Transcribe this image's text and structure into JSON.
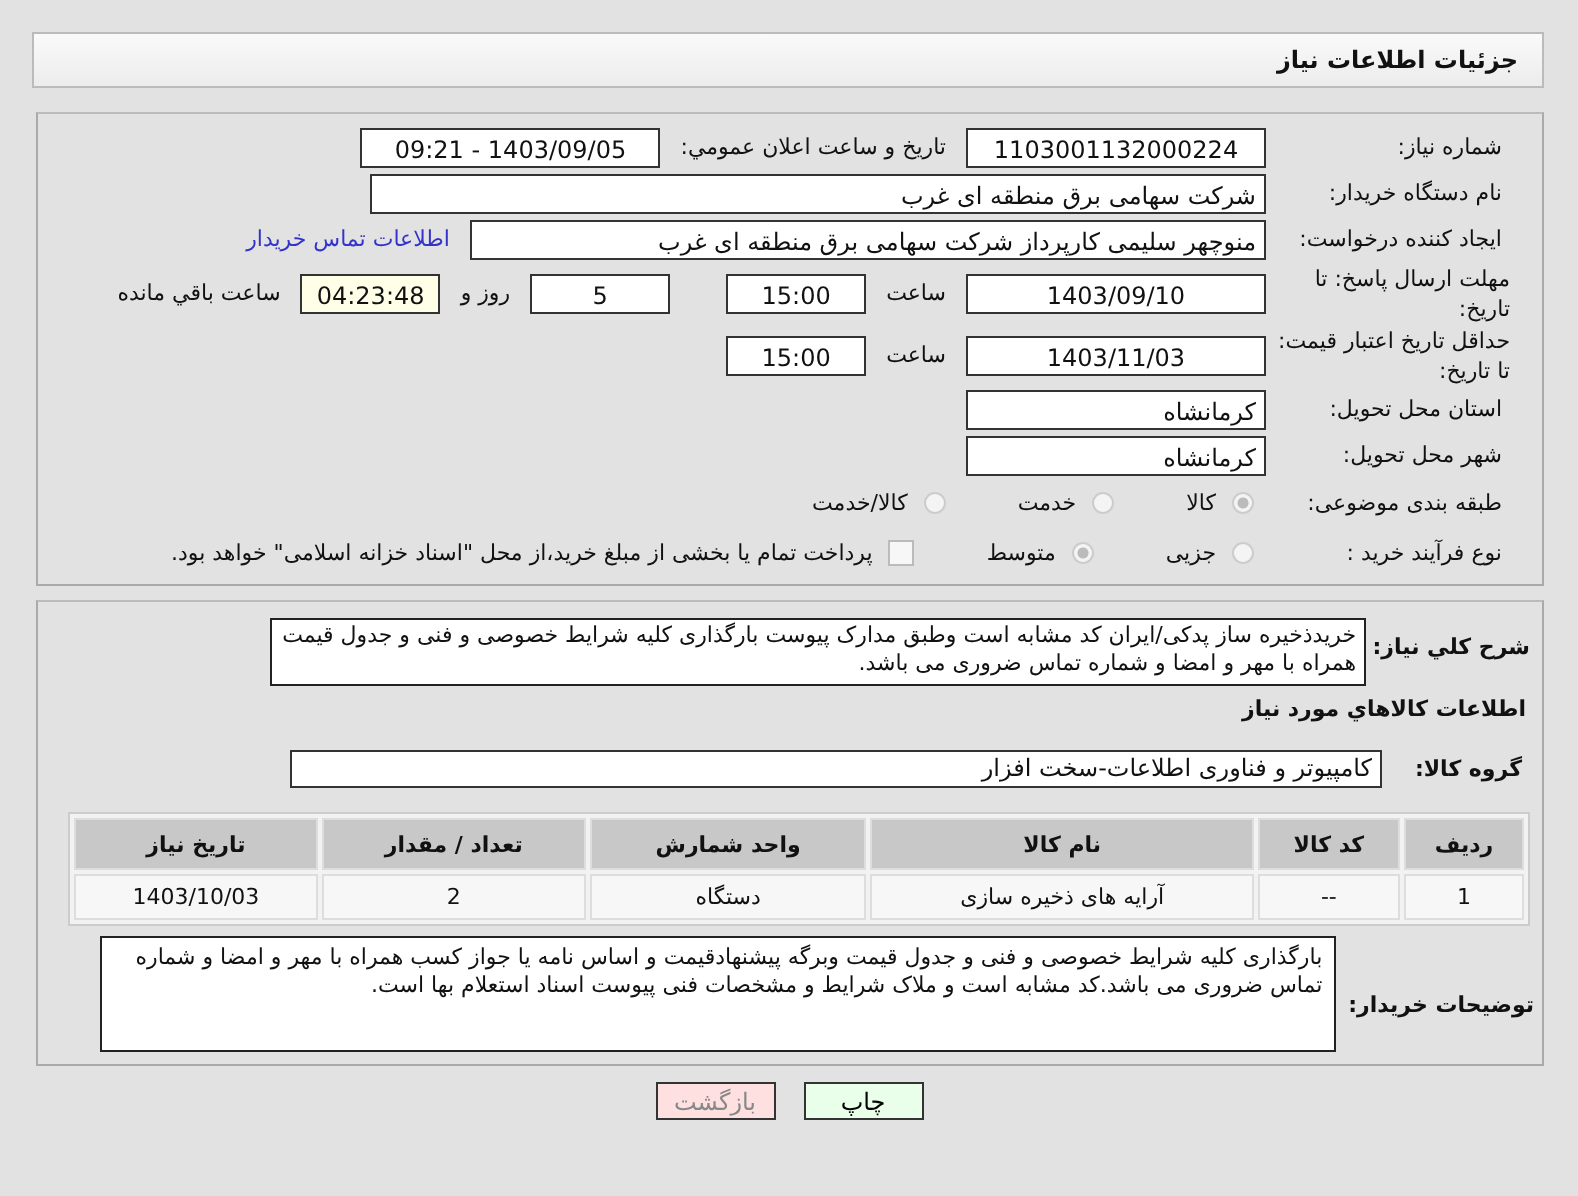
{
  "header": {
    "title": "جزئیات اطلاعات نیاز"
  },
  "need_number": {
    "label": "شماره نیاز:",
    "value": "1103001132000224"
  },
  "announce": {
    "label": "تاریخ و ساعت اعلان عمومي:",
    "value": "1403/09/05 - 09:21"
  },
  "buyer_org": {
    "label": "نام دستگاه خریدار:",
    "value": "شرکت سهامی برق منطقه ای غرب"
  },
  "requester": {
    "label": "ایجاد کننده درخواست:",
    "value": "منوچهر  سلیمی کارپرداز شرکت سهامی برق منطقه ای غرب",
    "link": "اطلاعات تماس خریدار"
  },
  "reply_deadline": {
    "label": "مهلت ارسال پاسخ: تا تاریخ:",
    "date": "1403/09/10",
    "time_label": "ساعت",
    "time": "15:00",
    "days": "5",
    "days_label": "روز و",
    "remaining": "04:23:48",
    "remaining_label": "ساعت باقي مانده"
  },
  "price_validity": {
    "label": "حداقل تاریخ اعتبار قیمت: تا تاریخ:",
    "date": "1403/11/03",
    "time_label": "ساعت",
    "time": "15:00"
  },
  "province": {
    "label": "استان محل تحویل:",
    "value": "کرمانشاه"
  },
  "city": {
    "label": "شهر محل تحویل:",
    "value": "کرمانشاه"
  },
  "category": {
    "label": "طبقه بندی موضوعی:",
    "options": [
      {
        "label": "کالا",
        "selected": true
      },
      {
        "label": "خدمت",
        "selected": false
      },
      {
        "label": "کالا/خدمت",
        "selected": false
      }
    ]
  },
  "purchase_type": {
    "label": "نوع فرآیند خرید :",
    "options": [
      {
        "label": "جزیی",
        "selected": false
      },
      {
        "label": "متوسط",
        "selected": true
      }
    ],
    "payment": {
      "checked": false,
      "label": "پرداخت تمام یا بخشی از مبلغ خرید،از محل \"اسناد خزانه اسلامی\" خواهد بود."
    }
  },
  "description": {
    "label": "شرح کلي نیاز:",
    "value": "خریدذخیره ساز پدکی/ایران کد مشابه است وطبق مدارک پیوست بارگذاری کلیه شرایط خصوصی و فنی و جدول قیمت همراه با مهر و امضا و شماره تماس ضروری می باشد."
  },
  "goods_heading": "اطلاعات کالاهاي مورد نیاز",
  "goods_group": {
    "label": "گروه کالا:",
    "value": "کامپیوتر و فناوری اطلاعات-سخت افزار"
  },
  "table": {
    "columns": [
      "ردیف",
      "کد کالا",
      "نام کالا",
      "واحد شمارش",
      "تعداد / مقدار",
      "تاریخ نیاز"
    ],
    "rows": [
      [
        "1",
        "--",
        "آرایه های ذخیره سازی",
        "دستگاه",
        "2",
        "1403/10/03"
      ]
    ]
  },
  "buyer_notes": {
    "label": "توضیحات خریدار:",
    "value": "بارگذاری کلیه شرایط خصوصی و فنی و جدول قیمت وبرگه پیشنهادقیمت و اساس نامه یا جواز کسب همراه با مهر و امضا و شماره تماس ضروری می باشد.کد مشابه است و ملاک شرایط و مشخصات فنی پیوست اسناد استعلام بها است."
  },
  "buttons": [
    {
      "kind": "print",
      "label": "چاپ"
    },
    {
      "kind": "back",
      "label": "بازگشت"
    }
  ]
}
